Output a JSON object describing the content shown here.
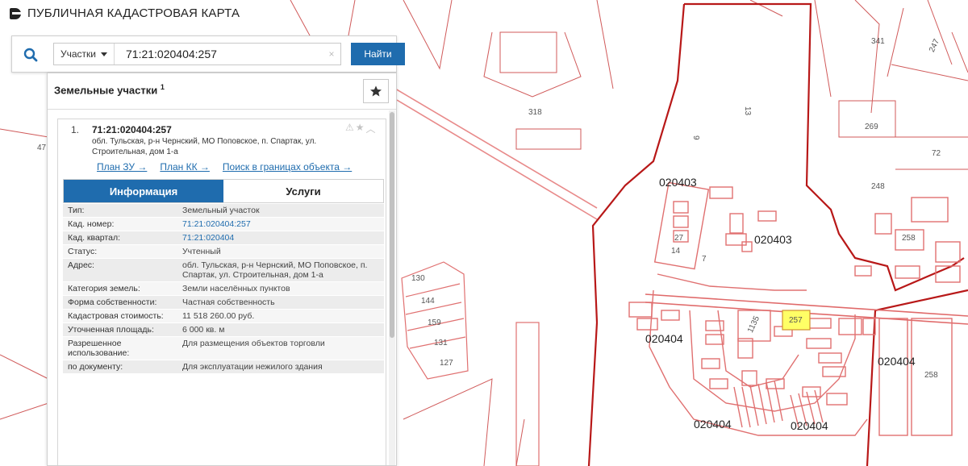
{
  "app": {
    "title": "ПУБЛИЧНАЯ КАДАСТРОВАЯ КАРТА",
    "logo_icon": "pkk-logo-icon"
  },
  "search": {
    "type_label": "Участки",
    "query": "71:21:020404:257",
    "clear_glyph": "×",
    "find_label": "Найти"
  },
  "results": {
    "header": "Земельные участки",
    "count": "1",
    "item": {
      "number": "1.",
      "cadastral_number": "71:21:020404:257",
      "address": "обл. Тульская, р-н Чернский, МО Поповское, п. Спартак, ул. Строительная, дом 1-а",
      "links": [
        "План ЗУ →",
        "План КК →",
        "Поиск в границах объекта →"
      ],
      "tabs": [
        "Информация",
        "Услуги"
      ],
      "fields": [
        {
          "key": "Тип:",
          "value": "Земельный участок",
          "link": false
        },
        {
          "key": "Кад. номер:",
          "value": "71:21:020404:257",
          "link": true
        },
        {
          "key": "Кад. квартал:",
          "value": "71:21:020404",
          "link": true
        },
        {
          "key": "Статус:",
          "value": "Учтенный",
          "link": false
        },
        {
          "key": "Адрес:",
          "value": "обл. Тульская, р-н Чернский, МО Поповское, п. Спартак, ул. Строительная, дом 1-а",
          "link": false
        },
        {
          "key": "Категория земель:",
          "value": "Земли населённых пунктов",
          "link": false
        },
        {
          "key": "Форма собственности:",
          "value": "Частная собственность",
          "link": false
        },
        {
          "key": "Кадастровая стоимость:",
          "value": "11 518 260.00 руб.",
          "link": false
        },
        {
          "key": "Уточненная площадь:",
          "value": "6 000 кв. м",
          "link": false
        },
        {
          "key": "Разрешенное использование:",
          "value": "Для размещения объектов торговли",
          "link": false
        },
        {
          "key": "по документу:",
          "value": "Для эксплуатации нежилого здания",
          "link": false
        }
      ]
    }
  },
  "map": {
    "labels": [
      "341",
      "247",
      "318",
      "269",
      "72",
      "248",
      "258",
      "130",
      "144",
      "159",
      "131",
      "127",
      "257",
      "1135",
      "020403",
      "020403",
      "020404",
      "020404",
      "020404",
      "020404",
      "020404",
      "258",
      "13",
      "9",
      "27",
      "14",
      "47",
      "7"
    ],
    "colors": {
      "boundary": "#c81e1e",
      "parcel": "#e07070",
      "road": "#f0b0b0",
      "highlight": "#ffff66"
    }
  }
}
